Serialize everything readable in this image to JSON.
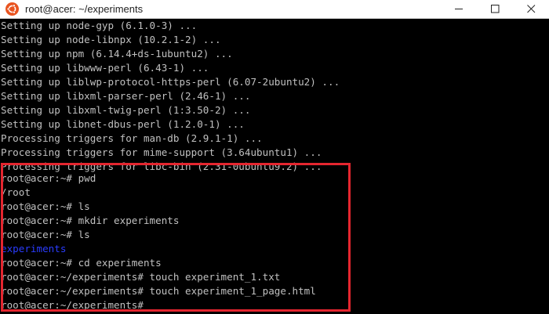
{
  "window": {
    "title": "root@acer: ~/experiments",
    "app_icon": "ubuntu-icon",
    "controls": {
      "minimize_icon": "minimize-icon",
      "maximize_icon": "maximize-icon",
      "close_icon": "close-icon"
    }
  },
  "terminal": {
    "lines": [
      "Setting up node-gyp (6.1.0-3) ...",
      "Setting up node-libnpx (10.2.1-2) ...",
      "Setting up npm (6.14.4+ds-1ubuntu2) ...",
      "Setting up libwww-perl (6.43-1) ...",
      "Setting up liblwp-protocol-https-perl (6.07-2ubuntu2) ...",
      "Setting up libxml-parser-perl (2.46-1) ...",
      "Setting up libxml-twig-perl (1:3.50-2) ...",
      "Setting up libnet-dbus-perl (1.2.0-1) ...",
      "Processing triggers for man-db (2.9.1-1) ...",
      "Processing triggers for mime-support (3.64ubuntu1) ...",
      "Processing triggers for libc-bin (2.31-0ubuntu9.2) ...",
      "root@acer:~# pwd",
      "/root",
      "root@acer:~# ls",
      "root@acer:~# mkdir experiments",
      "root@acer:~# ls",
      "experiments",
      "root@acer:~# cd experiments",
      "root@acer:~/experiments# touch experiment_1.txt",
      "root@acer:~/experiments# touch experiment_1_page.html",
      "root@acer:~/experiments#"
    ]
  },
  "colors": {
    "background": "#000000",
    "text": "#c0c0c0",
    "directory": "#2a3cff",
    "highlight_border": "#e5262f",
    "titlebar": "#ffffff"
  }
}
